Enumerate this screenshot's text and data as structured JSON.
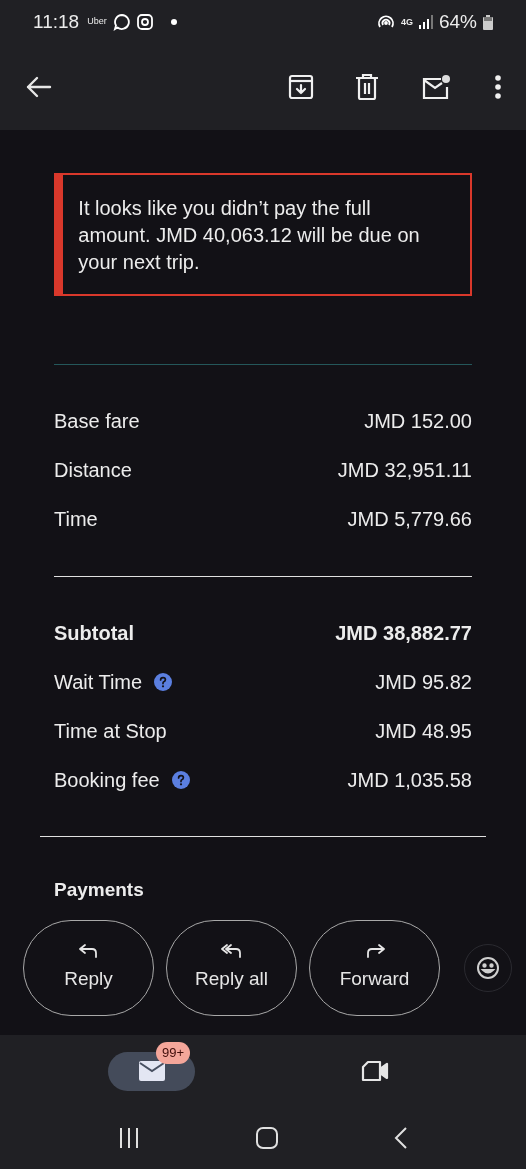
{
  "status_bar": {
    "time": "11:18",
    "app_label": "Uber",
    "battery": "64%",
    "network": "4G"
  },
  "alert": {
    "message": "It looks like you didn’t pay the full amount. JMD 40,063.12 will be due on your next trip."
  },
  "fare_items": [
    {
      "label": "Base fare",
      "amount": "JMD 152.00"
    },
    {
      "label": "Distance",
      "amount": "JMD 32,951.11"
    },
    {
      "label": "Time",
      "amount": "JMD 5,779.66"
    }
  ],
  "charges": [
    {
      "label": "Subtotal",
      "amount": "JMD 38,882.77",
      "kind": "subtotal",
      "info": false
    },
    {
      "label": "Wait Time",
      "amount": "JMD 95.82",
      "kind": "fee",
      "info": true
    },
    {
      "label": "Time at Stop",
      "amount": "JMD 48.95",
      "kind": "fee",
      "info": false
    },
    {
      "label": "Booking fee",
      "amount": "JMD 1,035.58",
      "kind": "fee",
      "info": true
    }
  ],
  "payments_heading": "Payments",
  "actions": [
    {
      "label": "Reply",
      "kind": "reply"
    },
    {
      "label": "Reply all",
      "kind": "reply_all"
    },
    {
      "label": "Forward",
      "kind": "forward"
    }
  ],
  "bottom_nav": [
    {
      "kind": "mail",
      "selected": true,
      "badge": "99+"
    },
    {
      "kind": "meet",
      "selected": false
    }
  ]
}
